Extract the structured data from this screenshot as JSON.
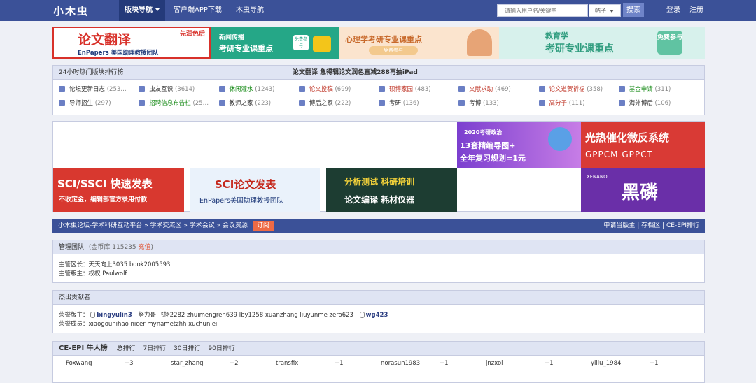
{
  "topnav": {
    "logo": "小木虫",
    "block_nav": "版块导航",
    "app_download": "客户端APP下载",
    "muchong_nav": "木虫导航",
    "search_placeholder": "请输入用户名/关键字",
    "search_type": "帖子",
    "search_button": "搜索",
    "login": "登录",
    "register": "注册"
  },
  "banner_ads": [
    {
      "title": "论文翻译",
      "tag": "先润色后",
      "sub": "EnPapers 美国助理教授团队"
    },
    {
      "title": "新闻传播",
      "sub": "考研专业课重点",
      "badge": "免费参与"
    },
    {
      "title": "心理学考研专业课重点",
      "badge": "免费参与"
    },
    {
      "title": "教育学",
      "sub": "考研专业课重点",
      "badge": "免费参与"
    }
  ],
  "hot": {
    "title": "24小时热门版块排行榜",
    "promo": "论文翻译  急得辑论文润色直减288再抽iPad",
    "items": [
      {
        "name": "论坛更新日志",
        "count": "(253…"
      },
      {
        "name": "虫友互识",
        "count": "(3614)"
      },
      {
        "name": "休闲灌水",
        "count": "(1243)"
      },
      {
        "name": "论文投稿",
        "count": "(699)"
      },
      {
        "name": "硕博家园",
        "count": "(483)"
      },
      {
        "name": "文献求助",
        "count": "(469)"
      },
      {
        "name": "论文道贺祈福",
        "count": "(358)"
      },
      {
        "name": "基金申请",
        "count": "(311)"
      },
      {
        "name": "导师招生",
        "count": "(297)"
      },
      {
        "name": "招聘信息布告栏",
        "count": "(25…"
      },
      {
        "name": "教师之家",
        "count": "(223)"
      },
      {
        "name": "博后之家",
        "count": "(222)"
      },
      {
        "name": "考研",
        "count": "(136)"
      },
      {
        "name": "考博",
        "count": "(133)"
      },
      {
        "name": "高分子",
        "count": "(111)"
      },
      {
        "name": "海外博后",
        "count": "(106)"
      }
    ],
    "colors": [
      "#333333",
      "#333333",
      "#1a8c1a",
      "#c0392b",
      "#c0392b",
      "#c0392b",
      "#c0392b",
      "#1a8c1a",
      "#333333",
      "#1a8c1a",
      "#333333",
      "#333333",
      "#333333",
      "#333333",
      "#c0392b",
      "#333333"
    ]
  },
  "grid_ads": {
    "kaoyan_line1": "2020考研政治",
    "kaoyan_line2": "13套精编导图+",
    "kaoyan_line3": "全年复习规划=1元",
    "guangre_title": "光热催化微反系统",
    "guangre_sub": "GPPCM  GPPCT",
    "sci_ssci_title": "SCI/SSCI 快速发表",
    "sci_ssci_sub": "不收定金，编辑部官方录用付款",
    "sci_title": "SCI论文发表",
    "sci_sub": "EnPapers美国助理教授团队",
    "fenxi_line1": "分析测试  科研培训",
    "fenxi_line2": "论文编译  耗材仪器",
    "heilin_brand": "XFNANO",
    "heilin_title": "黑磷"
  },
  "breadcrumb": {
    "path": "小木虫论坛-学术科研互动平台 » 学术交流区 » 学术会议 » 会议资源",
    "subscribe": "订阅",
    "apply_moderator": "申请当版主",
    "archive": "存档区",
    "ce_epi_rank": "CE-EPI排行"
  },
  "management": {
    "title": "管理团队",
    "fund": "(金币库 115235",
    "fund_link": "充值",
    "fund_end": ")",
    "area_label": "主管区长：",
    "area_names": "天天向上3035    book2005593",
    "mod_label": "主管版主：",
    "mod_names": "权权    Paulwolf"
  },
  "contributors": {
    "title": "杰出贡献者",
    "honor_mod_label": "荣誉版主：",
    "user1": "bingyulin3",
    "names_mid": "努力哥   飞扬2282   zhuimengren639   lby1258   xuanzhang   liuyunme   zero623",
    "user2": "wg423",
    "honor_member_label": "荣誉成员：",
    "members": "xiaogounihao   nicer   mynametzhh   xuchunlei"
  },
  "ce_epi": {
    "title": "CE-EPI 牛人榜",
    "tabs": [
      "总排行",
      "7日排行",
      "30日排行",
      "90日排行"
    ],
    "rows": [
      {
        "name": "Foxwang",
        "score": "+3"
      },
      {
        "name": "star_zhang",
        "score": "+2"
      },
      {
        "name": "transfix",
        "score": "+1"
      },
      {
        "name": "norasun1983",
        "score": "+1"
      },
      {
        "name": "jnzxol",
        "score": "+1"
      },
      {
        "name": "yiliu_1984",
        "score": "+1"
      }
    ]
  }
}
